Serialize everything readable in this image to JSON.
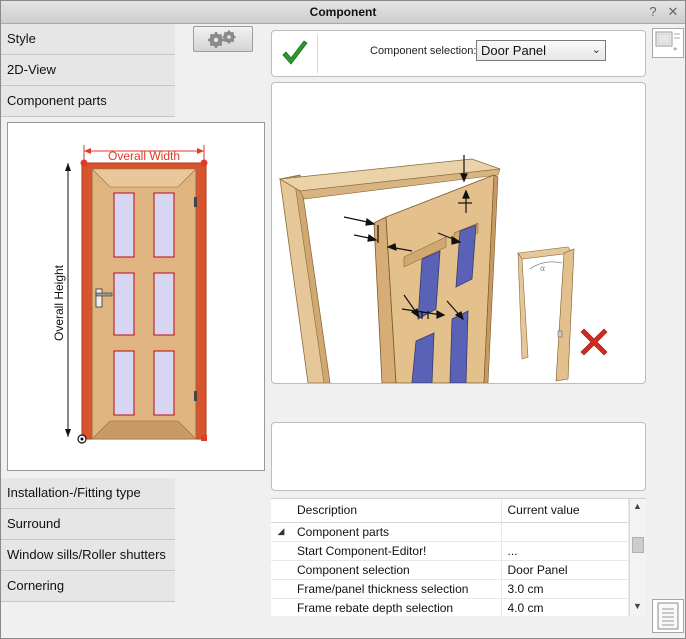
{
  "window": {
    "title": "Component",
    "help": "?",
    "close": "✕"
  },
  "sections_top": [
    "Style",
    "2D-View",
    "Component parts"
  ],
  "sections_bottom": [
    "Installation-/Fitting type",
    "Surround",
    "Window sills/Roller shutters",
    "Cornering"
  ],
  "preview": {
    "width_label": "Overall Width",
    "height_label": "Overall Height"
  },
  "component": {
    "label": "Component selection:",
    "value": "Door Panel"
  },
  "grid": {
    "headers": [
      "Description",
      "Current value"
    ],
    "group": "Component parts",
    "rows": [
      {
        "desc": "Start Component-Editor!",
        "value": "..."
      },
      {
        "desc": "Component selection",
        "value": "Door Panel"
      },
      {
        "desc": "Frame/panel thickness selection",
        "value": "3.0 cm"
      },
      {
        "desc": "Frame rebate depth selection",
        "value": "4.0 cm"
      }
    ]
  },
  "colors": {
    "accent_red": "#e03a2a",
    "door_wood": "#e0b480",
    "frame_orange": "#d8542c",
    "check_green": "#2c9a2c"
  },
  "icons": [
    "help-icon",
    "close-icon",
    "gear-icon",
    "checkmark-icon",
    "view-toggle-icon",
    "remove-x-icon",
    "notes-icon",
    "expand-triangle-icon",
    "scroll-up-icon",
    "scroll-down-icon"
  ]
}
